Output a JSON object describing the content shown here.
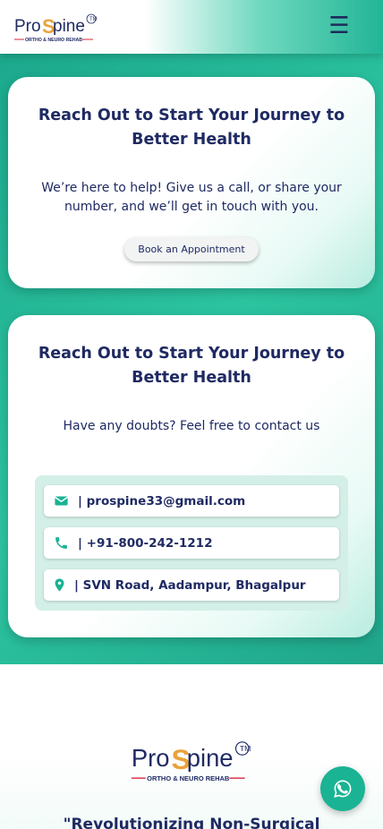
{
  "header": {
    "logo": {
      "brand_left": "Pro",
      "brand_right": "Spine",
      "tagline": "ORTHO & NEURO REHAB",
      "mark": "TM"
    },
    "menu_icon": "☰"
  },
  "appointment_card": {
    "title": "Reach Out to Start Your Journey to Better Health",
    "text": "We’re here to help! Give us a call, or share your number, and we’ll get in touch with you.",
    "button_label": "Book an Appointment"
  },
  "contact_card": {
    "title": "Reach Out to Start Your Journey to Better Health",
    "text": "Have any doubts? Feel free to contact us",
    "items": [
      {
        "icon": "envelope-icon",
        "label": "| prospine33@gmail.com"
      },
      {
        "icon": "phone-icon",
        "label": "| +91-800-242-1212"
      },
      {
        "icon": "map-marker-icon",
        "label": "| SVN Road, Aadampur, Bhagalpur"
      }
    ]
  },
  "footer": {
    "logo": {
      "brand_left": "Pro",
      "brand_right": "Spine",
      "tagline": "ORTHO & NEURO REHAB",
      "mark": "TM"
    },
    "tagline": "\"Revolutionizing Non-Surgical"
  },
  "floating": {
    "icon": "whatsapp-icon"
  },
  "colors": {
    "accent": "#1ab394",
    "navy": "#1f2a63",
    "brand_orange": "#e9a23b",
    "brand_red": "#d7263d"
  }
}
